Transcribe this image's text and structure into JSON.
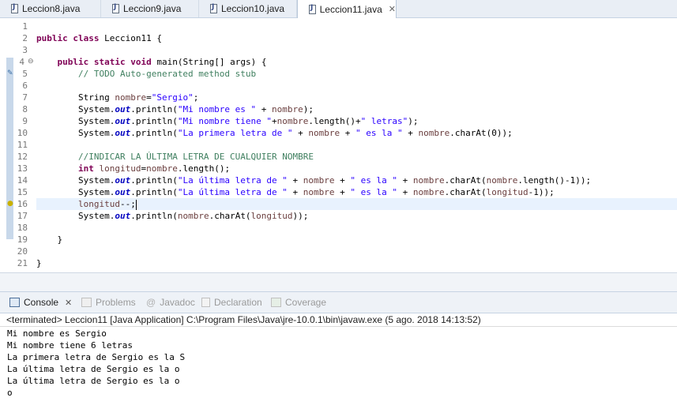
{
  "editor_tabs": [
    {
      "label": "Leccion8.java",
      "active": false
    },
    {
      "label": "Leccion9.java",
      "active": false
    },
    {
      "label": "Leccion10.java",
      "active": false
    },
    {
      "label": "Leccion11.java",
      "active": true
    }
  ],
  "tab_close_glyph": "✕",
  "code": {
    "line_numbers": [
      "1",
      "2",
      "3",
      "4",
      "5",
      "6",
      "7",
      "8",
      "9",
      "10",
      "11",
      "12",
      "13",
      "14",
      "15",
      "16",
      "17",
      "18",
      "19",
      "20",
      "21"
    ],
    "l2": {
      "kw1": "public",
      "kw2": "class",
      "rest": " Leccion11 {"
    },
    "l4": {
      "kw1": "public",
      "kw2": "static",
      "kw3": "void",
      "rest": " main(String[] args) {"
    },
    "l5": "// TODO Auto-generated method stub",
    "l7": {
      "type": "String ",
      "var": "nombre",
      "eq": "=",
      "str": "\"Sergio\"",
      "end": ";"
    },
    "l8": {
      "sys": "System.",
      "out": "out",
      "pre": ".println(",
      "str": "\"Mi nombre es \"",
      "mid": " + ",
      "var": "nombre",
      "end": ");"
    },
    "l9": {
      "sys": "System.",
      "out": "out",
      "pre": ".println(",
      "str1": "\"Mi nombre tiene \"",
      "mid1": "+",
      "var": "nombre",
      "mid2": ".length()+",
      "str2": "\" letras\"",
      "end": ");"
    },
    "l10": {
      "sys": "System.",
      "out": "out",
      "pre": ".println(",
      "str1": "\"La primera letra de \"",
      "mid1": " + ",
      "var1": "nombre",
      "mid2": " + ",
      "str2": "\" es la \"",
      "mid3": " + ",
      "var2": "nombre",
      "end": ".charAt(0));"
    },
    "l12": "//INDICAR LA ÚLTIMA LETRA DE CUALQUIER NOMBRE",
    "l13": {
      "kw": "int",
      "sp": " ",
      "var1": "longitud",
      "eq": "=",
      "var2": "nombre",
      "end": ".length();"
    },
    "l14": {
      "sys": "System.",
      "out": "out",
      "pre": ".println(",
      "str1": "\"La última letra de \"",
      "mid1": " + ",
      "var1": "nombre",
      "mid2": " + ",
      "str2": "\" es la \"",
      "mid3": " + ",
      "var2": "nombre",
      "mid4": ".charAt(",
      "var3": "nombre",
      "end": ".length()-1));"
    },
    "l15": {
      "sys": "System.",
      "out": "out",
      "pre": ".println(",
      "str1": "\"La última letra de \"",
      "mid1": " + ",
      "var1": "nombre",
      "mid2": " + ",
      "str2": "\" es la \"",
      "mid3": " + ",
      "var2": "nombre",
      "mid4": ".charAt(",
      "var3": "longitud",
      "end": "-1));"
    },
    "l16": {
      "var": "longitud",
      "end": "--;"
    },
    "l17": {
      "sys": "System.",
      "out": "out",
      "pre": ".println(",
      "var1": "nombre",
      "mid": ".charAt(",
      "var2": "longitud",
      "end": "));"
    },
    "l19": "}",
    "l21": "}"
  },
  "panel_tabs": [
    {
      "label": "Console",
      "active": true,
      "icon": "console-icon"
    },
    {
      "label": "Problems",
      "active": false,
      "icon": "problems-icon"
    },
    {
      "label": "Javadoc",
      "active": false,
      "icon": "at-icon"
    },
    {
      "label": "Declaration",
      "active": false,
      "icon": "declaration-icon"
    },
    {
      "label": "Coverage",
      "active": false,
      "icon": "coverage-icon"
    }
  ],
  "console_close_glyph": "✕",
  "console_status": "<terminated> Leccion11 [Java Application] C:\\Program Files\\Java\\jre-10.0.1\\bin\\javaw.exe (5 ago. 2018 14:13:52)",
  "console_output": [
    "Mi nombre es Sergio",
    "Mi nombre tiene 6 letras",
    "La primera letra de Sergio es la S",
    "La última letra de Sergio es la o",
    "La última letra de Sergio es la o",
    "o"
  ]
}
